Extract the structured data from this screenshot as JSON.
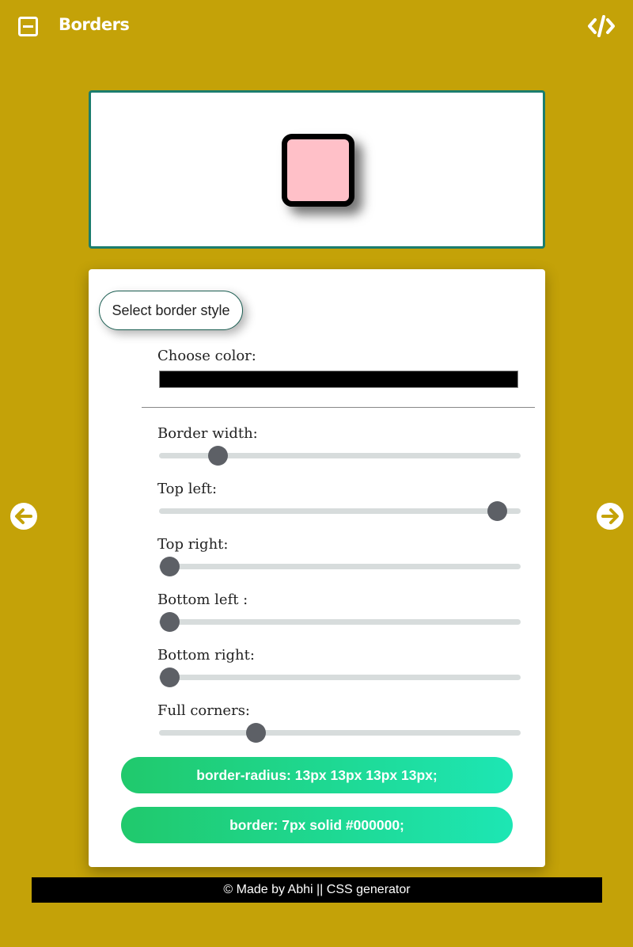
{
  "header": {
    "title": "Borders",
    "menu_icon": "minus-square-icon",
    "code_icon": "code-icon"
  },
  "preview": {
    "shape_fill": "#ffc0c8",
    "border_color": "#000000"
  },
  "controls": {
    "style_select_label": "Select border style",
    "color_label": "Choose color:",
    "color_value": "#000000",
    "sliders": [
      {
        "label": "Border width:",
        "value": 0.14
      },
      {
        "label": "Top left:",
        "value": 0.95
      },
      {
        "label": "Top right:",
        "value": 0.0
      },
      {
        "label": "Bottom left :",
        "value": 0.0
      },
      {
        "label": "Bottom right:",
        "value": 0.0
      },
      {
        "label": "Full corners:",
        "value": 0.25
      }
    ]
  },
  "output": {
    "radius_code": "border-radius: 13px 13px 13px 13px;",
    "border_code": "border: 7px solid #000000;"
  },
  "nav": {
    "prev_icon": "arrow-left-circle-icon",
    "next_icon": "arrow-right-circle-icon"
  },
  "footer": {
    "text": "© Made by Abhi || CSS generator"
  }
}
